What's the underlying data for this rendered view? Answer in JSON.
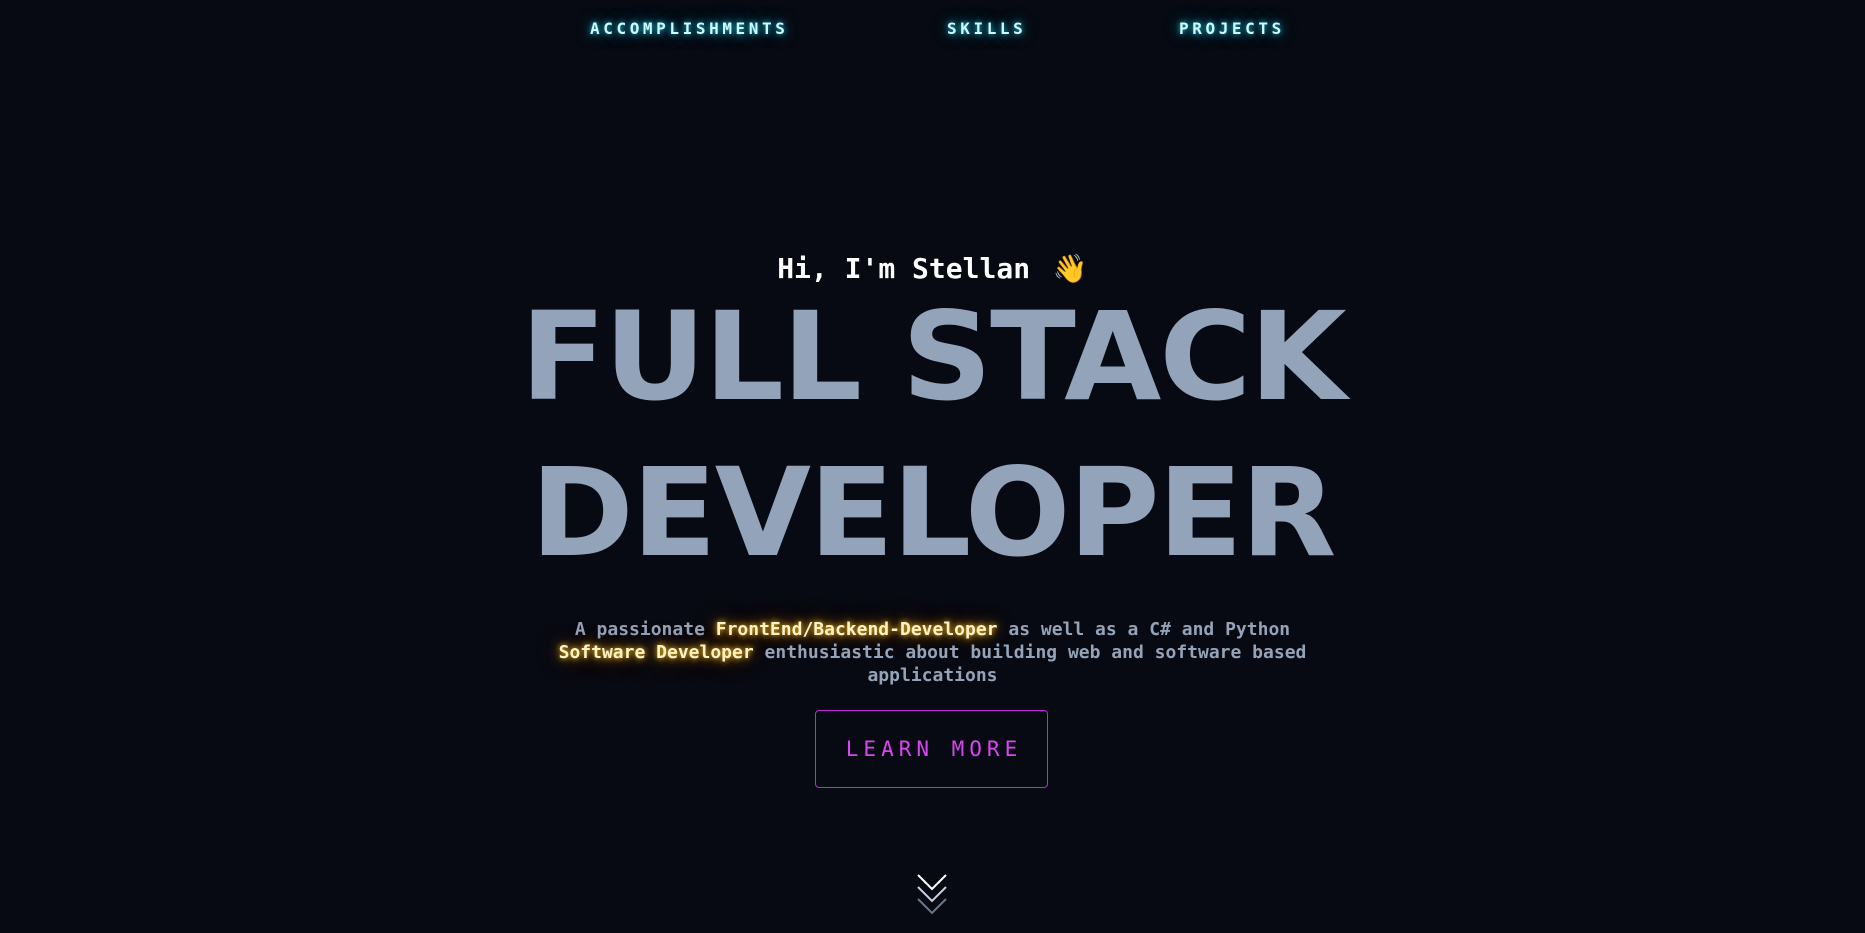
{
  "nav": {
    "items": [
      {
        "label": "ACCOMPLISHMENTS"
      },
      {
        "label": "SKILLS"
      },
      {
        "label": "PROJECTS"
      }
    ]
  },
  "hero": {
    "greeting": "Hi, I'm Stellan",
    "greeting_emoji": "👋",
    "title_line1": "FULL STACK",
    "title_line2": "DEVELOPER",
    "tagline": {
      "part1": "A passionate ",
      "highlight1": "FrontEnd/Backend-Developer",
      "part2": " as well as a C# and Python ",
      "highlight2": "Software Developer",
      "part3": " enthusiastic about building web and software based applications"
    },
    "cta_label": "LEARN MORE"
  },
  "icons": {
    "greeting": "waving-hand-icon",
    "scroll": "chevron-double-down-icon"
  },
  "colors": {
    "background": "#070a12",
    "nav_glow": "#22d3ee",
    "title": "#93a3b9",
    "highlight": "#fbbf24",
    "cta": "#d946ef"
  }
}
